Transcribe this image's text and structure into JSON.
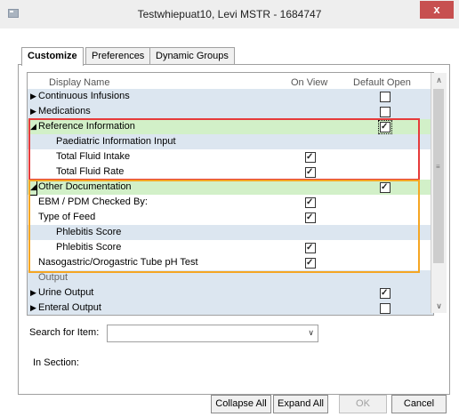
{
  "window": {
    "title": "Testwhiepuat10, Levi  MSTR - 1684747",
    "close_glyph": "x"
  },
  "tabs": [
    {
      "label": "Customize",
      "active": true
    },
    {
      "label": "Preferences",
      "active": false
    },
    {
      "label": "Dynamic Groups",
      "active": false
    }
  ],
  "grid": {
    "columns": {
      "name": "Display Name",
      "view": "On View",
      "default": "Default Open"
    },
    "rows": [
      {
        "label": "Continuous Infusions",
        "expander": "collapsed",
        "level": 0,
        "on_view": null,
        "default_open": false,
        "section": true
      },
      {
        "label": "Medications",
        "expander": "collapsed",
        "level": 0,
        "on_view": null,
        "default_open": false,
        "section": true
      },
      {
        "label": "Reference Information",
        "expander": "expanded",
        "level": 0,
        "on_view": null,
        "default_open": true,
        "section": true,
        "green": true
      },
      {
        "label": "Paediatric Information Input",
        "expander": null,
        "level": 1,
        "on_view": null,
        "default_open": null,
        "sub": true
      },
      {
        "label": "Total Fluid Intake",
        "expander": null,
        "level": 1,
        "on_view": true,
        "default_open": null
      },
      {
        "label": "Total Fluid Rate",
        "expander": null,
        "level": 1,
        "on_view": true,
        "default_open": null
      },
      {
        "label": "Other Documentation",
        "expander": "expanded",
        "level": 0,
        "on_view": null,
        "default_open": true,
        "section": true,
        "green": true
      },
      {
        "label": "EBM / PDM Checked By:",
        "expander": null,
        "level": 0,
        "on_view": true,
        "default_open": null
      },
      {
        "label": "Type of Feed",
        "expander": null,
        "level": 0,
        "on_view": true,
        "default_open": null
      },
      {
        "label": "Phlebitis Score",
        "expander": null,
        "level": 1,
        "on_view": null,
        "default_open": null,
        "sub": true
      },
      {
        "label": "Phlebitis Score",
        "expander": null,
        "level": 1,
        "on_view": true,
        "default_open": null
      },
      {
        "label": "Nasogastric/Orogastric Tube pH Test",
        "expander": null,
        "level": 0,
        "on_view": true,
        "default_open": null
      },
      {
        "label": "Output",
        "expander": null,
        "level": 0,
        "on_view": null,
        "default_open": null,
        "section": true,
        "muted": true
      },
      {
        "label": "Urine Output",
        "expander": "collapsed",
        "level": 0,
        "on_view": null,
        "default_open": true,
        "section": true
      },
      {
        "label": "Enteral Output",
        "expander": "collapsed",
        "level": 0,
        "on_view": null,
        "default_open": false,
        "section": true
      }
    ]
  },
  "search": {
    "label": "Search for Item:",
    "value": ""
  },
  "in_section": {
    "label": "In Section:"
  },
  "buttons": {
    "collapse_all": "Collapse All",
    "expand_all": "Expand All",
    "ok": "OK",
    "cancel": "Cancel"
  },
  "colors": {
    "highlight_red": "#e63b3b",
    "highlight_orange": "#f5a623",
    "section_band": "#dce6f0",
    "expanded_band": "#d2f0c8"
  }
}
